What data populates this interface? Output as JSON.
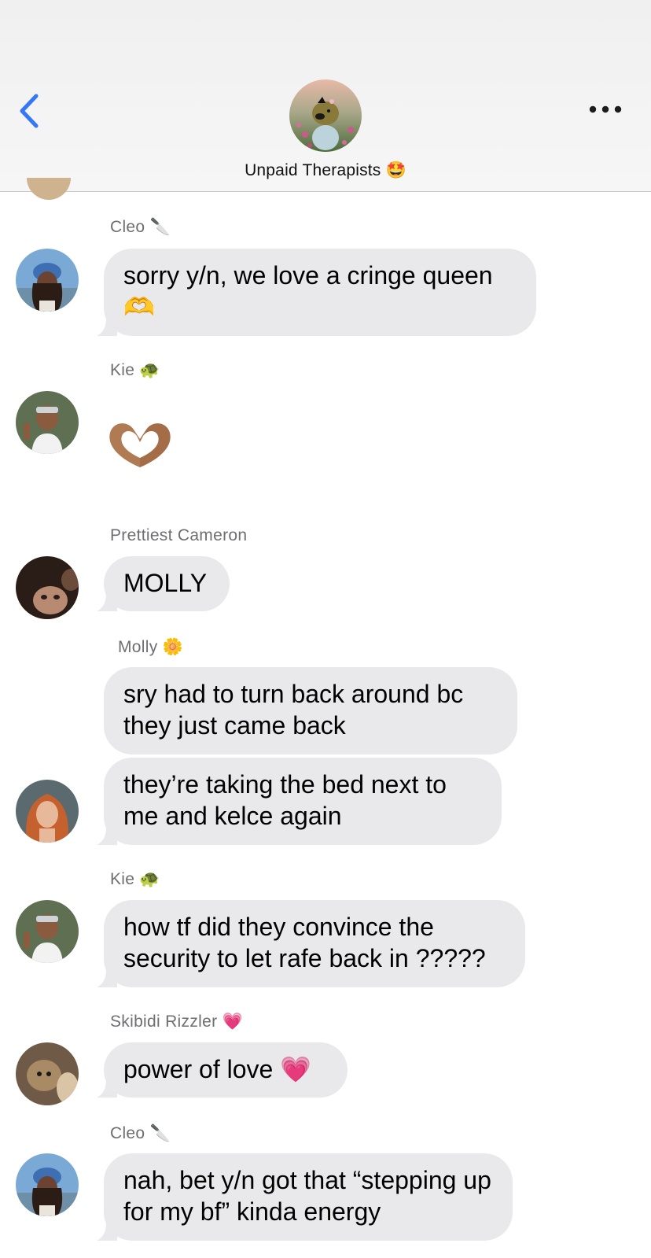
{
  "header": {
    "title": "Unpaid Therapists",
    "title_emoji": "🤩",
    "back_icon": "chevron-left-icon",
    "more_icon": "ellipsis-icon",
    "accent_color": "#3478f6"
  },
  "messages": [
    {
      "sender": "Cleo",
      "sender_emoji": "🔪",
      "text": "sorry y/n, we love a cringe queen",
      "text_emoji": "🫶"
    },
    {
      "sender": "Kie",
      "sender_emoji": "🐢",
      "emoji_only": "🫶"
    },
    {
      "sender": "Prettiest Cameron",
      "text": "MOLLY"
    },
    {
      "sender": "Molly",
      "sender_emoji": "🌼",
      "text": "sry had to turn back around bc they just came back"
    },
    {
      "text": "they’re taking the bed next to me and kelce again"
    },
    {
      "sender": "Kie",
      "sender_emoji": "🐢",
      "text": "how tf did they convince the security to let rafe back in ?????"
    },
    {
      "sender": "Skibidi Rizzler",
      "sender_emoji": "💗",
      "text": "power of love",
      "text_emoji": "💗"
    },
    {
      "sender": "Cleo",
      "sender_emoji": "🔪",
      "text": "nah, bet y/n got that “stepping up for my bf” kinda energy"
    }
  ],
  "colors": {
    "bubble": "#e9e9eb",
    "sender_label": "#6e6e73",
    "header_bg": "#f2f2f2"
  }
}
